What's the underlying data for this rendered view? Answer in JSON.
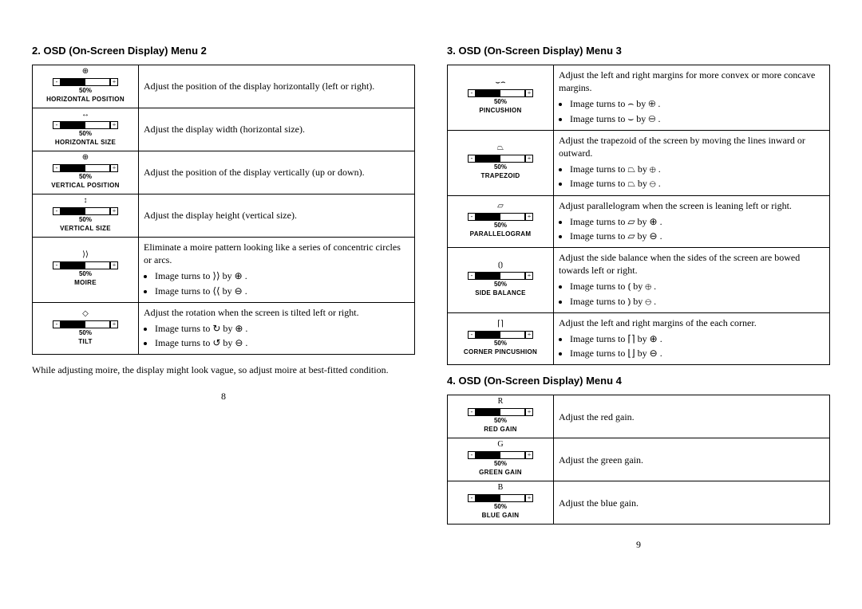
{
  "left": {
    "heading": "2. OSD (On-Screen Display) Menu 2",
    "rows": [
      {
        "label": "HORIZONTAL POSITION",
        "pct": "50%",
        "desc": "Adjust the position of the display horizontally (left or right)."
      },
      {
        "label": "HORIZONTAL SIZE",
        "pct": "50%",
        "desc": "Adjust the display width (horizontal size)."
      },
      {
        "label": "VERTICAL POSITION",
        "pct": "50%",
        "desc": "Adjust the position of the display vertically (up or down)."
      },
      {
        "label": "VERTICAL SIZE",
        "pct": "50%",
        "desc": "Adjust the display height (vertical size)."
      },
      {
        "label": "MOIRE",
        "pct": "50%",
        "desc": "Eliminate a moire pattern looking like a series of concentric circles or arcs.",
        "bullets": [
          "Image turns to   ⟩⟩   by   ⊕  .",
          "Image turns to   ⟨⟨   by   ⊖  ."
        ]
      },
      {
        "label": "TILT",
        "pct": "50%",
        "desc": "Adjust the rotation when the screen is tilted left or right.",
        "bullets": [
          "Image turns to   ↻   by   ⊕  .",
          "Image turns to   ↺   by   ⊖  ."
        ]
      }
    ],
    "note": "While adjusting moire, the display might look vague, so adjust moire at best-fitted condition.",
    "page_num": "8"
  },
  "right_a": {
    "heading": "3. OSD (On-Screen Display) Menu 3",
    "rows": [
      {
        "label": "PINCUSHION",
        "pct": "50%",
        "desc": "Adjust the left and right margins for more convex or more concave margins.",
        "bullets": [
          "Image turns to   ⌢   by   ⊕  .",
          "Image turns to   ⌣   by   ⊖  ."
        ]
      },
      {
        "label": "TRAPEZOID",
        "pct": "50%",
        "desc": "Adjust the trapezoid of the screen by moving the lines inward or outward.",
        "bullets": [
          "Image turns to   ⏢   by   ⊕  .",
          "Image turns to   ⏢   by   ⊖  ."
        ]
      },
      {
        "label": "PARALLELOGRAM",
        "pct": "50%",
        "desc": "Adjust parallelogram when the screen is leaning left or right.",
        "bullets": [
          "Image turns to   ▱   by   ⊕  .",
          "Image turns to   ▱   by   ⊖  ."
        ]
      },
      {
        "label": "SIDE BALANCE",
        "pct": "50%",
        "desc": "Adjust the side balance when the sides of the screen are bowed towards left or right.",
        "bullets": [
          "Image turns to   ⦅   by   ⊕  .",
          "Image turns to   ⦆   by   ⊖  ."
        ]
      },
      {
        "label": "CORNER PINCUSHION",
        "pct": "50%",
        "desc": "Adjust the left and right margins of the each corner.",
        "bullets": [
          "Image turns to   ⌈⌉   by   ⊕  .",
          "Image turns to   ⌊⌋   by   ⊖  ."
        ]
      }
    ]
  },
  "right_b": {
    "heading": "4. OSD (On-Screen Display) Menu 4",
    "rows": [
      {
        "label": "RED GAIN",
        "pct": "50%",
        "desc": "Adjust the red gain."
      },
      {
        "label": "GREEN GAIN",
        "pct": "50%",
        "desc": "Adjust the green gain."
      },
      {
        "label": "BLUE GAIN",
        "pct": "50%",
        "desc": "Adjust the blue gain."
      }
    ],
    "page_num": "9"
  },
  "glyphs": {
    "hpos": "⊕",
    "hsize": "↔",
    "vpos": "⊕",
    "vsize": "↕",
    "moire": "⟩⟩",
    "tilt": "◇",
    "pincushion": "⌣⌢",
    "trapezoid": "⏢",
    "parallelogram": "▱",
    "sidebalance": "⦅⦆",
    "cornerpin": "⌈⌉",
    "red": "R",
    "green": "G",
    "blue": "B"
  }
}
